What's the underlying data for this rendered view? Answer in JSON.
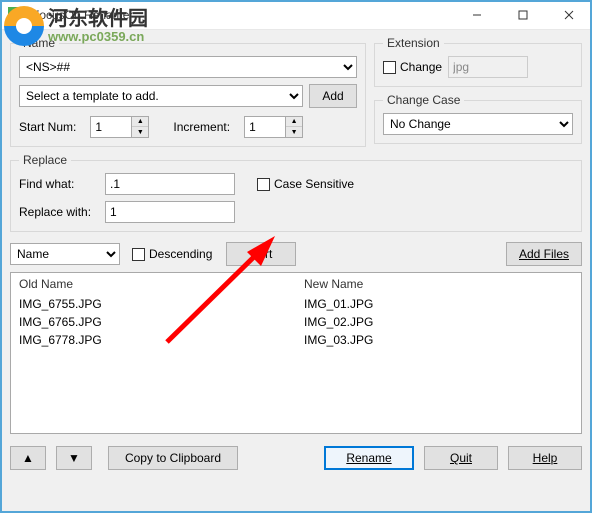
{
  "window": {
    "title": "FocusOn Renamer"
  },
  "watermark": {
    "cn": "河东软件园",
    "url": "www.pc0359.cn"
  },
  "name_group": {
    "legend": "Name",
    "pattern": "<NS>##",
    "template_placeholder": "Select a template to add.",
    "add_btn": "Add",
    "start_label": "Start Num:",
    "start_val": "1",
    "incr_label": "Increment:",
    "incr_val": "1"
  },
  "ext_group": {
    "legend": "Extension",
    "change_label": "Change",
    "ext_value": "jpg",
    "case_legend": "Change Case",
    "case_value": "No Change"
  },
  "replace_group": {
    "legend": "Replace",
    "find_label": "Find what:",
    "find_val": ".1",
    "with_label": "Replace with:",
    "with_val": "1",
    "cs_label": "Case Sensitive"
  },
  "sortbar": {
    "field": "Name",
    "desc_label": "Descending",
    "sort_btn": "Sort",
    "addfiles_btn": "Add Files"
  },
  "list": {
    "old_hdr": "Old Name",
    "new_hdr": "New Name",
    "old": [
      "IMG_6755.JPG",
      "IMG_6765.JPG",
      "IMG_6778.JPG"
    ],
    "new": [
      "IMG_01.JPG",
      "IMG_02.JPG",
      "IMG_03.JPG"
    ]
  },
  "bottom": {
    "copy_btn": "Copy to Clipboard",
    "rename_btn": "Rename",
    "quit_btn": "Quit",
    "help_btn": "Help"
  }
}
